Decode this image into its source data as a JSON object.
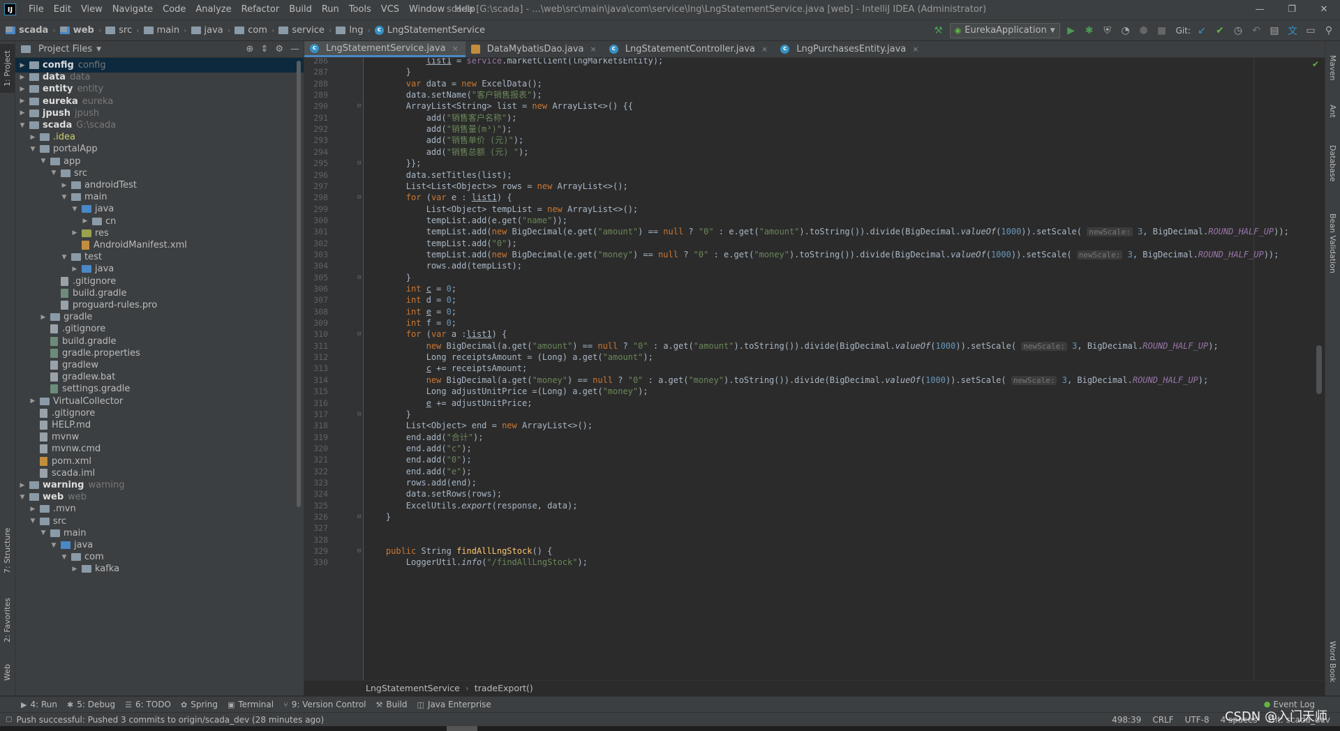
{
  "app": {
    "logo": "IJ",
    "window_title": "scada [G:\\scada] - ...\\web\\src\\main\\java\\com\\service\\lng\\LngStatementService.java [web] - IntelliJ IDEA (Administrator)",
    "menu": [
      "File",
      "Edit",
      "View",
      "Navigate",
      "Code",
      "Analyze",
      "Refactor",
      "Build",
      "Run",
      "Tools",
      "VCS",
      "Window",
      "Help"
    ],
    "win_controls": [
      "—",
      "❐",
      "✕"
    ]
  },
  "navbar": {
    "crumbs": [
      "scada",
      "web",
      "src",
      "main",
      "java",
      "com",
      "service",
      "lng",
      "LngStatementService"
    ],
    "run_config": "EurekaApplication",
    "git_label": "Git:"
  },
  "left_strip": {
    "project_tab": "1: Project",
    "structure_tab": "7: Structure",
    "favorites_tab": "2: Favorites",
    "web_tab": "Web"
  },
  "right_strip": {
    "tabs": [
      "Maven",
      "Ant",
      "Database",
      "Bean Validation",
      "Word Book"
    ]
  },
  "project": {
    "title": "Project Files",
    "tree": [
      {
        "depth": 0,
        "arrow": "▶",
        "name": "config",
        "hint": "config",
        "kind": "module",
        "bold": true,
        "selected": true
      },
      {
        "depth": 0,
        "arrow": "▶",
        "name": "data",
        "hint": "data",
        "kind": "module",
        "bold": true
      },
      {
        "depth": 0,
        "arrow": "▶",
        "name": "entity",
        "hint": "entity",
        "kind": "module",
        "bold": true
      },
      {
        "depth": 0,
        "arrow": "▶",
        "name": "eureka",
        "hint": "eureka",
        "kind": "module",
        "bold": true
      },
      {
        "depth": 0,
        "arrow": "▶",
        "name": "jpush",
        "hint": "jpush",
        "kind": "module",
        "bold": true
      },
      {
        "depth": 0,
        "arrow": "▼",
        "name": "scada",
        "hint": "G:\\scada",
        "kind": "module",
        "bold": true
      },
      {
        "depth": 1,
        "arrow": "▶",
        "name": ".idea",
        "hint": "",
        "kind": "idea"
      },
      {
        "depth": 1,
        "arrow": "▼",
        "name": "portalApp",
        "hint": "",
        "kind": "folder"
      },
      {
        "depth": 2,
        "arrow": "▼",
        "name": "app",
        "hint": "",
        "kind": "folder"
      },
      {
        "depth": 3,
        "arrow": "▼",
        "name": "src",
        "hint": "",
        "kind": "folder"
      },
      {
        "depth": 4,
        "arrow": "▶",
        "name": "androidTest",
        "hint": "",
        "kind": "folder"
      },
      {
        "depth": 4,
        "arrow": "▼",
        "name": "main",
        "hint": "",
        "kind": "folder"
      },
      {
        "depth": 5,
        "arrow": "▼",
        "name": "java",
        "hint": "",
        "kind": "src"
      },
      {
        "depth": 6,
        "arrow": "▶",
        "name": "cn",
        "hint": "",
        "kind": "folder"
      },
      {
        "depth": 5,
        "arrow": "▶",
        "name": "res",
        "hint": "",
        "kind": "res"
      },
      {
        "depth": 5,
        "arrow": "",
        "name": "AndroidManifest.xml",
        "hint": "",
        "kind": "xml"
      },
      {
        "depth": 4,
        "arrow": "▼",
        "name": "test",
        "hint": "",
        "kind": "folder"
      },
      {
        "depth": 5,
        "arrow": "▶",
        "name": "java",
        "hint": "",
        "kind": "src"
      },
      {
        "depth": 3,
        "arrow": "",
        "name": ".gitignore",
        "hint": "",
        "kind": "file"
      },
      {
        "depth": 3,
        "arrow": "",
        "name": "build.gradle",
        "hint": "",
        "kind": "gradle"
      },
      {
        "depth": 3,
        "arrow": "",
        "name": "proguard-rules.pro",
        "hint": "",
        "kind": "file"
      },
      {
        "depth": 2,
        "arrow": "▶",
        "name": "gradle",
        "hint": "",
        "kind": "folder"
      },
      {
        "depth": 2,
        "arrow": "",
        "name": ".gitignore",
        "hint": "",
        "kind": "file"
      },
      {
        "depth": 2,
        "arrow": "",
        "name": "build.gradle",
        "hint": "",
        "kind": "gradle"
      },
      {
        "depth": 2,
        "arrow": "",
        "name": "gradle.properties",
        "hint": "",
        "kind": "gradle"
      },
      {
        "depth": 2,
        "arrow": "",
        "name": "gradlew",
        "hint": "",
        "kind": "file"
      },
      {
        "depth": 2,
        "arrow": "",
        "name": "gradlew.bat",
        "hint": "",
        "kind": "file"
      },
      {
        "depth": 2,
        "arrow": "",
        "name": "settings.gradle",
        "hint": "",
        "kind": "gradle"
      },
      {
        "depth": 1,
        "arrow": "▶",
        "name": "VirtualCollector",
        "hint": "",
        "kind": "folder"
      },
      {
        "depth": 1,
        "arrow": "",
        "name": ".gitignore",
        "hint": "",
        "kind": "file"
      },
      {
        "depth": 1,
        "arrow": "",
        "name": "HELP.md",
        "hint": "",
        "kind": "file"
      },
      {
        "depth": 1,
        "arrow": "",
        "name": "mvnw",
        "hint": "",
        "kind": "file"
      },
      {
        "depth": 1,
        "arrow": "",
        "name": "mvnw.cmd",
        "hint": "",
        "kind": "file"
      },
      {
        "depth": 1,
        "arrow": "",
        "name": "pom.xml",
        "hint": "",
        "kind": "xml"
      },
      {
        "depth": 1,
        "arrow": "",
        "name": "scada.iml",
        "hint": "",
        "kind": "file"
      },
      {
        "depth": 0,
        "arrow": "▶",
        "name": "warning",
        "hint": "warning",
        "kind": "module",
        "bold": true
      },
      {
        "depth": 0,
        "arrow": "▼",
        "name": "web",
        "hint": "web",
        "kind": "module",
        "bold": true
      },
      {
        "depth": 1,
        "arrow": "▶",
        "name": ".mvn",
        "hint": "",
        "kind": "folder"
      },
      {
        "depth": 1,
        "arrow": "▼",
        "name": "src",
        "hint": "",
        "kind": "folder"
      },
      {
        "depth": 2,
        "arrow": "▼",
        "name": "main",
        "hint": "",
        "kind": "folder"
      },
      {
        "depth": 3,
        "arrow": "▼",
        "name": "java",
        "hint": "",
        "kind": "src"
      },
      {
        "depth": 4,
        "arrow": "▼",
        "name": "com",
        "hint": "",
        "kind": "folder"
      },
      {
        "depth": 5,
        "arrow": "▶",
        "name": "kafka",
        "hint": "",
        "kind": "folder"
      }
    ]
  },
  "tabs": [
    {
      "label": "LngStatementService.java",
      "icon": "class",
      "active": true
    },
    {
      "label": "DataMybatisDao.java",
      "icon": "jar",
      "active": false
    },
    {
      "label": "LngStatementController.java",
      "icon": "class",
      "active": false
    },
    {
      "label": "LngPurchasesEntity.java",
      "icon": "class",
      "active": false
    }
  ],
  "code_lines": [
    {
      "n": "286",
      "html": "            <span class='u'>list1</span> = <span class='const' style='font-style:normal;color:#9876aa'>service</span>.marketClient(lngMarketsEntity);"
    },
    {
      "n": "287",
      "html": "        }"
    },
    {
      "n": "288",
      "html": "        <span class='kw'>var</span> data = <span class='kw'>new</span> ExcelData();"
    },
    {
      "n": "289",
      "html": "        data.setName(<span class='str'>\"客户销售报表\"</span>);"
    },
    {
      "n": "290",
      "html": "        ArrayList&lt;String&gt; list = <span class='kw'>new</span> ArrayList&lt;&gt;() {{",
      "fold": true
    },
    {
      "n": "291",
      "html": "            add(<span class='str'>\"销售客户名称\"</span>);"
    },
    {
      "n": "292",
      "html": "            add(<span class='str'>\"销售量(m³)\"</span>);"
    },
    {
      "n": "293",
      "html": "            add(<span class='str'>\"销售单价 (元)\"</span>);"
    },
    {
      "n": "294",
      "html": "            add(<span class='str'>\"销售总额 (元) \"</span>);"
    },
    {
      "n": "295",
      "html": "        }};",
      "fold": true
    },
    {
      "n": "296",
      "html": "        data.setTitles(list);"
    },
    {
      "n": "297",
      "html": "        List&lt;List&lt;Object&gt;&gt; rows = <span class='kw'>new</span> ArrayList&lt;&gt;();"
    },
    {
      "n": "298",
      "html": "        <span class='kw'>for</span> (<span class='kw'>var</span> e : <span class='u'>list1</span>) {",
      "fold": true
    },
    {
      "n": "299",
      "html": "            List&lt;Object&gt; tempList = <span class='kw'>new</span> ArrayList&lt;&gt;();"
    },
    {
      "n": "300",
      "html": "            tempList.add(e.get(<span class='str'>\"name\"</span>));"
    },
    {
      "n": "301",
      "html": "            tempList.add(<span class='kw'>new</span> BigDecimal(e.get(<span class='str'>\"amount\"</span>) == <span class='kw'>null</span> ? <span class='str'>\"0\"</span> : e.get(<span class='str'>\"amount\"</span>).toString()).divide(BigDecimal.<span class='it'>valueOf</span>(<span class='num'>1000</span>)).setScale( <span class='hint'>newScale:</span> <span class='num'>3</span>, BigDecimal.<span class='const'>ROUND_HALF_UP</span>));"
    },
    {
      "n": "302",
      "html": "            tempList.add(<span class='str'>\"0\"</span>);"
    },
    {
      "n": "303",
      "html": "            tempList.add(<span class='kw'>new</span> BigDecimal(e.get(<span class='str'>\"money\"</span>) == <span class='kw'>null</span> ? <span class='str'>\"0\"</span> : e.get(<span class='str'>\"money\"</span>).toString()).divide(BigDecimal.<span class='it'>valueOf</span>(<span class='num'>1000</span>)).setScale( <span class='hint'>newScale:</span> <span class='num'>3</span>, BigDecimal.<span class='const'>ROUND_HALF_UP</span>));"
    },
    {
      "n": "304",
      "html": "            rows.add(tempList);"
    },
    {
      "n": "305",
      "html": "        }",
      "fold": true
    },
    {
      "n": "306",
      "html": "        <span class='kw'>int</span> <span class='u'>c</span> = <span class='num'>0</span>;"
    },
    {
      "n": "307",
      "html": "        <span class='kw'>int</span> d = <span class='num'>0</span>;"
    },
    {
      "n": "308",
      "html": "        <span class='kw'>int</span> <span class='u'>e</span> = <span class='num'>0</span>;"
    },
    {
      "n": "309",
      "html": "        <span class='kw'>int</span> f = <span class='num'>0</span>;"
    },
    {
      "n": "310",
      "html": "        <span class='kw'>for</span> (<span class='kw'>var</span> a :<span class='u'>list1</span>) {",
      "fold": true
    },
    {
      "n": "311",
      "html": "            <span class='kw'>new</span> BigDecimal(a.get(<span class='str'>\"amount\"</span>) == <span class='kw'>null</span> ? <span class='str'>\"0\"</span> : a.get(<span class='str'>\"amount\"</span>).toString()).divide(BigDecimal.<span class='it'>valueOf</span>(<span class='num'>1000</span>)).setScale( <span class='hint'>newScale:</span> <span class='num'>3</span>, BigDecimal.<span class='const'>ROUND_HALF_UP</span>);"
    },
    {
      "n": "312",
      "html": "            Long receiptsAmount = (Long) a.get(<span class='str'>\"amount\"</span>);"
    },
    {
      "n": "313",
      "html": "            <span class='u'>c</span> += receiptsAmount;"
    },
    {
      "n": "314",
      "html": "            <span class='kw'>new</span> BigDecimal(a.get(<span class='str'>\"money\"</span>) == <span class='kw'>null</span> ? <span class='str'>\"0\"</span> : a.get(<span class='str'>\"money\"</span>).toString()).divide(BigDecimal.<span class='it'>valueOf</span>(<span class='num'>1000</span>)).setScale( <span class='hint'>newScale:</span> <span class='num'>3</span>, BigDecimal.<span class='const'>ROUND_HALF_UP</span>);"
    },
    {
      "n": "315",
      "html": "            Long adjustUnitPrice =(Long) a.get(<span class='str'>\"money\"</span>);"
    },
    {
      "n": "316",
      "html": "            <span class='u'>e</span> += adjustUnitPrice;"
    },
    {
      "n": "317",
      "html": "        }",
      "fold": true
    },
    {
      "n": "318",
      "html": "        List&lt;Object&gt; end = <span class='kw'>new</span> ArrayList&lt;&gt;();"
    },
    {
      "n": "319",
      "html": "        end.add(<span class='str'>\"合计\"</span>);"
    },
    {
      "n": "320",
      "html": "        end.add(<span class='str'>\"c\"</span>);"
    },
    {
      "n": "321",
      "html": "        end.add(<span class='str'>\"0\"</span>);"
    },
    {
      "n": "322",
      "html": "        end.add(<span class='str'>\"e\"</span>);"
    },
    {
      "n": "323",
      "html": "        rows.add(end);"
    },
    {
      "n": "324",
      "html": "        data.setRows(rows);"
    },
    {
      "n": "325",
      "html": "        ExcelUtils.<span class='it'>export</span>(response, data);"
    },
    {
      "n": "326",
      "html": "    }",
      "fold": true
    },
    {
      "n": "327",
      "html": ""
    },
    {
      "n": "328",
      "html": ""
    },
    {
      "n": "329",
      "html": "    <span class='kw'>public</span> String <span class='fn'>findAllLngStock</span>() {",
      "fold": true
    },
    {
      "n": "330",
      "html": "        LoggerUtil.<span class='it'>info</span>(<span class='str'>\"/findAllLngStock\"</span>);"
    }
  ],
  "editor_crumbs": [
    "LngStatementService",
    "tradeExport()"
  ],
  "bottom_tabs": [
    {
      "icon": "▶",
      "label": "4: Run"
    },
    {
      "icon": "✱",
      "label": "5: Debug"
    },
    {
      "icon": "☰",
      "label": "6: TODO"
    },
    {
      "icon": "✿",
      "label": "Spring"
    },
    {
      "icon": "▣",
      "label": "Terminal"
    },
    {
      "icon": "⑂",
      "label": "9: Version Control"
    },
    {
      "icon": "⚒",
      "label": "Build"
    },
    {
      "icon": "◫",
      "label": "Java Enterprise"
    }
  ],
  "event_log": "Event Log",
  "status": {
    "message": "Push successful: Pushed 3 commits to origin/scada_dev (28 minutes ago)",
    "position": "498:39",
    "line_sep": "CRLF",
    "encoding": "UTF-8",
    "indent": "4 spaces",
    "git": "Git: scada_dev"
  },
  "watermark": "CSDN @入门天师"
}
